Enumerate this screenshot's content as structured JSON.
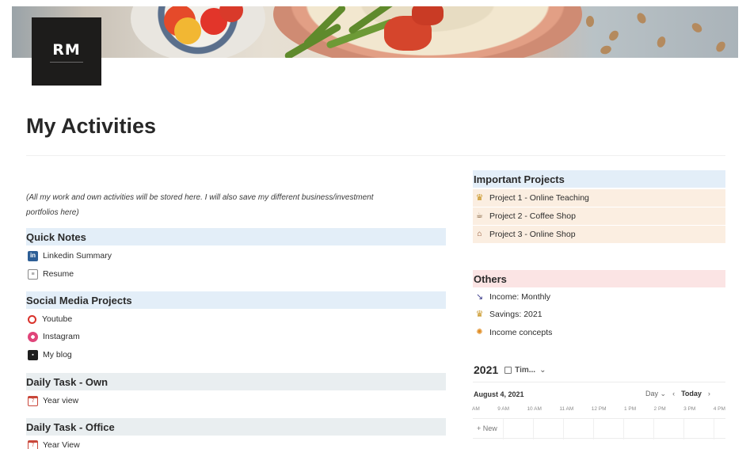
{
  "logo": {
    "text": "RM"
  },
  "page": {
    "title": "My Activities"
  },
  "intro": {
    "text": "(All my work and own activities will be stored here. I will also save my different business/investment portfolios here)"
  },
  "left_sections": [
    {
      "header": "Quick Notes",
      "items": [
        {
          "label": "Linkedin Summary",
          "icon": "linkedin-icon"
        },
        {
          "label": "Resume",
          "icon": "document-icon"
        }
      ]
    },
    {
      "header": "Social Media Projects",
      "items": [
        {
          "label": "Youtube",
          "icon": "youtube-icon"
        },
        {
          "label": "Instagram",
          "icon": "instagram-icon"
        },
        {
          "label": "My blog",
          "icon": "blog-icon"
        }
      ]
    },
    {
      "header": "Daily Task - Own",
      "items": [
        {
          "label": "Year view",
          "icon": "calendar-icon"
        }
      ]
    },
    {
      "header": "Daily Task - Office",
      "items": [
        {
          "label": "Year View",
          "icon": "calendar-icon"
        }
      ]
    }
  ],
  "important_projects": {
    "header": "Important Projects",
    "items": [
      {
        "label": "Project 1 - Online Teaching",
        "icon": "trophy-icon"
      },
      {
        "label": "Project 2 - Coffee Shop",
        "icon": "coffee-icon"
      },
      {
        "label": "Project 3 - Online Shop",
        "icon": "shop-icon"
      }
    ]
  },
  "others": {
    "header": "Others",
    "items": [
      {
        "label": "Income: Monthly",
        "icon": "chart-icon"
      },
      {
        "label": "Savings: 2021",
        "icon": "trophy-icon"
      },
      {
        "label": "Income concepts",
        "icon": "bulb-icon"
      }
    ]
  },
  "timeline": {
    "title": "2021",
    "view_label": "Tim...",
    "date": "August 4, 2021",
    "zoom": "Day",
    "today_label": "Today",
    "hours": [
      "AM",
      "9 AM",
      "10 AM",
      "11 AM",
      "12 PM",
      "1 PM",
      "2 PM",
      "3 PM",
      "4 PM"
    ],
    "new_label": "New"
  },
  "colors": {
    "blue_header": "#e3eef8",
    "gray_header": "#e9eef0",
    "pink_header": "#fbe4e4",
    "project_row": "#fbeee1"
  }
}
